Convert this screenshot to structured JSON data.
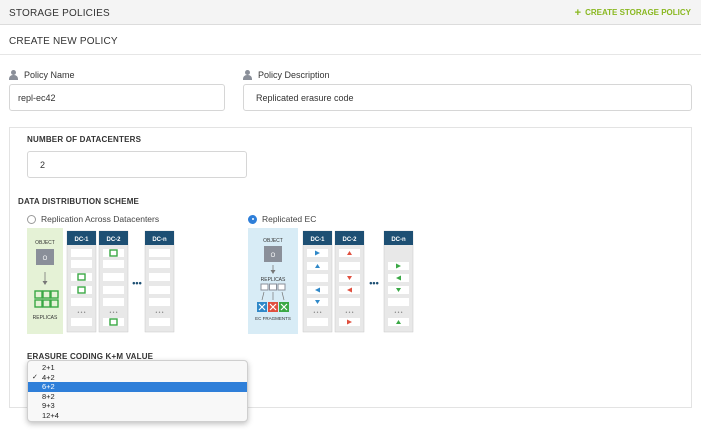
{
  "header": {
    "title": "STORAGE POLICIES",
    "create_label": "CREATE STORAGE POLICY"
  },
  "subheader": {
    "title": "CREATE NEW POLICY"
  },
  "form": {
    "policy_name_label": "Policy Name",
    "policy_name_value": "repl-ec42",
    "policy_description_label": "Policy Description",
    "policy_description_value": "Replicated erasure code",
    "datacenters_label": "NUMBER OF DATACENTERS",
    "datacenters_value": "2",
    "scheme_label": "DATA DISTRIBUTION SCHEME",
    "scheme_options": [
      {
        "label": "Replication Across Datacenters",
        "selected": false
      },
      {
        "label": "Replicated EC",
        "selected": true
      }
    ],
    "erasure_label": "ERASURE CODING K+M VALUE",
    "erasure_options": [
      {
        "label": "2+1",
        "checked": false,
        "highlighted": false
      },
      {
        "label": "4+2",
        "checked": true,
        "highlighted": false
      },
      {
        "label": "6+2",
        "checked": false,
        "highlighted": true
      },
      {
        "label": "8+2",
        "checked": false,
        "highlighted": false
      },
      {
        "label": "9+3",
        "checked": false,
        "highlighted": false
      },
      {
        "label": "12+4",
        "checked": false,
        "highlighted": false
      }
    ]
  },
  "replication_diagram": {
    "object_label": "OBJECT",
    "object_glyph": "O",
    "replicas_label": "REPLICAS",
    "dc_labels": [
      "DC-1",
      "DC-2",
      "DC-n"
    ],
    "dots": "•••",
    "mini_dots": "• • •"
  },
  "ec_diagram": {
    "object_label": "OBJECT",
    "object_glyph": "O",
    "replicas_label": "REPLICAS",
    "fragments_label": "EC FRAGMENTS",
    "dc_labels": [
      "DC-1",
      "DC-2",
      "DC-n"
    ],
    "dots": "•••",
    "mini_dots": "• • •"
  },
  "colors": {
    "accent_green": "#8ab821",
    "dc_header": "#1d4f73",
    "select_blue": "#2f7fd9",
    "replica_green": "#3aa845",
    "arrow_blue": "#2f88c8",
    "arrow_red": "#e0503f",
    "arrow_green": "#3aa845"
  }
}
